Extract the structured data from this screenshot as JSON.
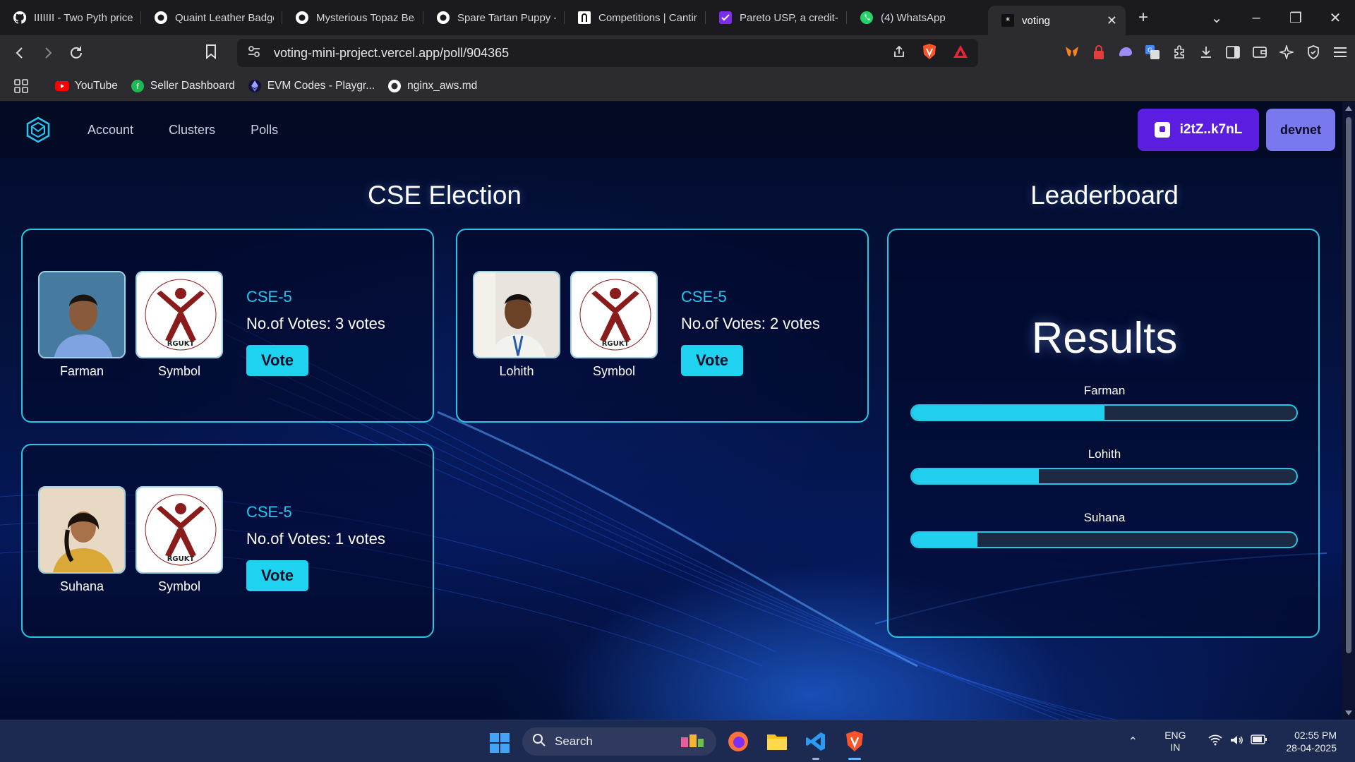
{
  "browser": {
    "tabs": [
      {
        "title": "IIIIIII - Two Pyth price",
        "icon": "github-icon"
      },
      {
        "title": "Quaint Leather Badge",
        "icon": "github-icon"
      },
      {
        "title": "Mysterious Topaz Bea",
        "icon": "github-icon"
      },
      {
        "title": "Spare Tartan Puppy -",
        "icon": "github-icon"
      },
      {
        "title": "Competitions | Cantin",
        "icon": "cantina-icon"
      },
      {
        "title": "Pareto USP, a credit-l",
        "icon": "pareto-icon"
      },
      {
        "title": "(4) WhatsApp",
        "icon": "whatsapp-icon"
      },
      {
        "title": "voting",
        "icon": "vercel-icon",
        "active": true
      }
    ],
    "url": "voting-mini-project.vercel.app/poll/904365",
    "bookmarks": [
      {
        "label": "YouTube",
        "icon": "youtube-icon"
      },
      {
        "label": "Seller Dashboard",
        "icon": "seller-icon"
      },
      {
        "label": "EVM Codes - Playgr...",
        "icon": "ethereum-icon"
      },
      {
        "label": "nginx_aws.md",
        "icon": "github-icon"
      }
    ]
  },
  "app": {
    "nav": [
      "Account",
      "Clusters",
      "Polls"
    ],
    "wallet": "i2tZ..k7nL",
    "network": "devnet",
    "poll_title": "CSE Election",
    "leaderboard_title": "Leaderboard",
    "results_title": "Results",
    "candidates": [
      {
        "name": "Farman",
        "class": "CSE-5",
        "votes_text": "No.of Votes: 3 votes",
        "votes": 3,
        "symbol_label": "Symbol",
        "vote_label": "Vote"
      },
      {
        "name": "Lohith",
        "class": "CSE-5",
        "votes_text": "No.of Votes: 2 votes",
        "votes": 2,
        "symbol_label": "Symbol",
        "vote_label": "Vote"
      },
      {
        "name": "Suhana",
        "class": "CSE-5",
        "votes_text": "No.of Votes: 1 votes",
        "votes": 1,
        "symbol_label": "Symbol",
        "vote_label": "Vote"
      }
    ],
    "results": [
      {
        "name": "Farman",
        "fraction": 0.5
      },
      {
        "name": "Lohith",
        "fraction": 0.33
      },
      {
        "name": "Suhana",
        "fraction": 0.17
      }
    ],
    "symbol_text": "RGUKT",
    "symbol_ring_text": "Rajiv Gandhi University of Knowledge Technologies"
  },
  "taskbar": {
    "search_label": "Search",
    "lang": "ENG",
    "region": "IN",
    "time": "02:55 PM",
    "date": "28-04-2025"
  },
  "colors": {
    "accent": "#22cfee",
    "wallet": "#5b1ee0",
    "network": "#7a78ee"
  }
}
